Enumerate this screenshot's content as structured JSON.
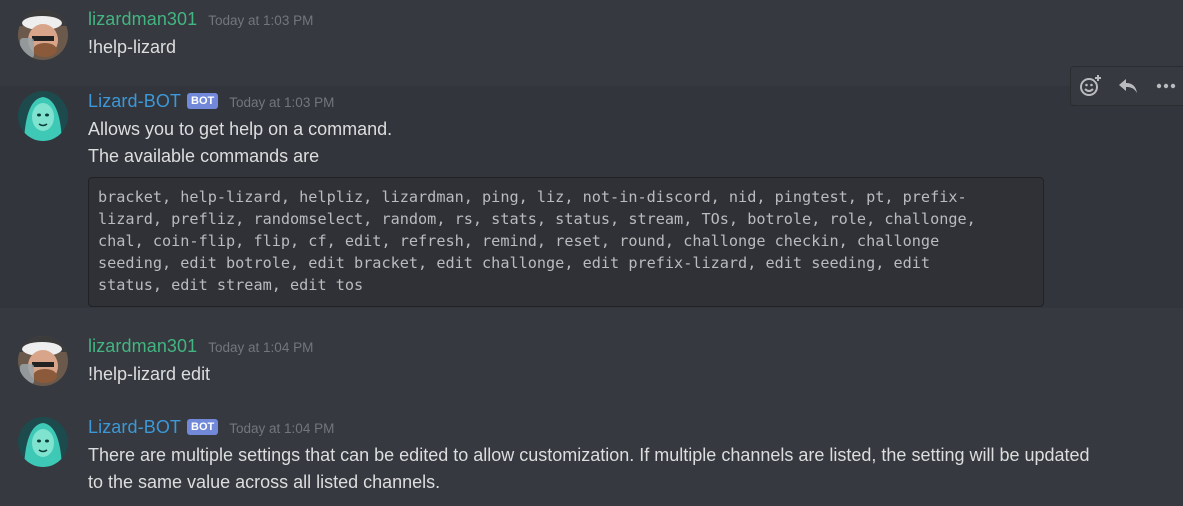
{
  "messages": [
    {
      "username": "lizardman301",
      "timestamp": "Today at 1:03 PM",
      "lines": [
        "!help-lizard"
      ]
    },
    {
      "username": "Lizard-BOT",
      "bot_tag": "BOT",
      "timestamp": "Today at 1:03 PM",
      "lines": [
        "Allows you to get help on a command.",
        "The available commands are"
      ],
      "code": "bracket, help-lizard, helpliz, lizardman, ping, liz, not-in-discord, nid, pingtest, pt, prefix-\nlizard, prefliz, randomselect, random, rs, stats, status, stream, TOs, botrole, role, challonge,\nchal, coin-flip, flip, cf, edit, refresh, remind, reset, round, challonge checkin, challonge\nseeding, edit botrole, edit bracket, edit challonge, edit prefix-lizard, edit seeding, edit\nstatus, edit stream, edit tos"
    },
    {
      "username": "lizardman301",
      "timestamp": "Today at 1:04 PM",
      "lines": [
        "!help-lizard edit"
      ]
    },
    {
      "username": "Lizard-BOT",
      "bot_tag": "BOT",
      "timestamp": "Today at 1:04 PM",
      "lines": [
        "There are multiple settings that can be edited to allow customization. If multiple channels are listed, the setting will be updated",
        "to the same value across all listed channels."
      ]
    }
  ],
  "toolbar": {
    "icons": [
      "add-reaction-icon",
      "reply-icon",
      "more-options-icon"
    ]
  },
  "colors": {
    "background": "#36393f",
    "human_username": "#43b581",
    "bot_username": "#3d98d8",
    "bot_tag": "#7289da",
    "timestamp": "#72767d",
    "code_background": "#2f3136"
  }
}
